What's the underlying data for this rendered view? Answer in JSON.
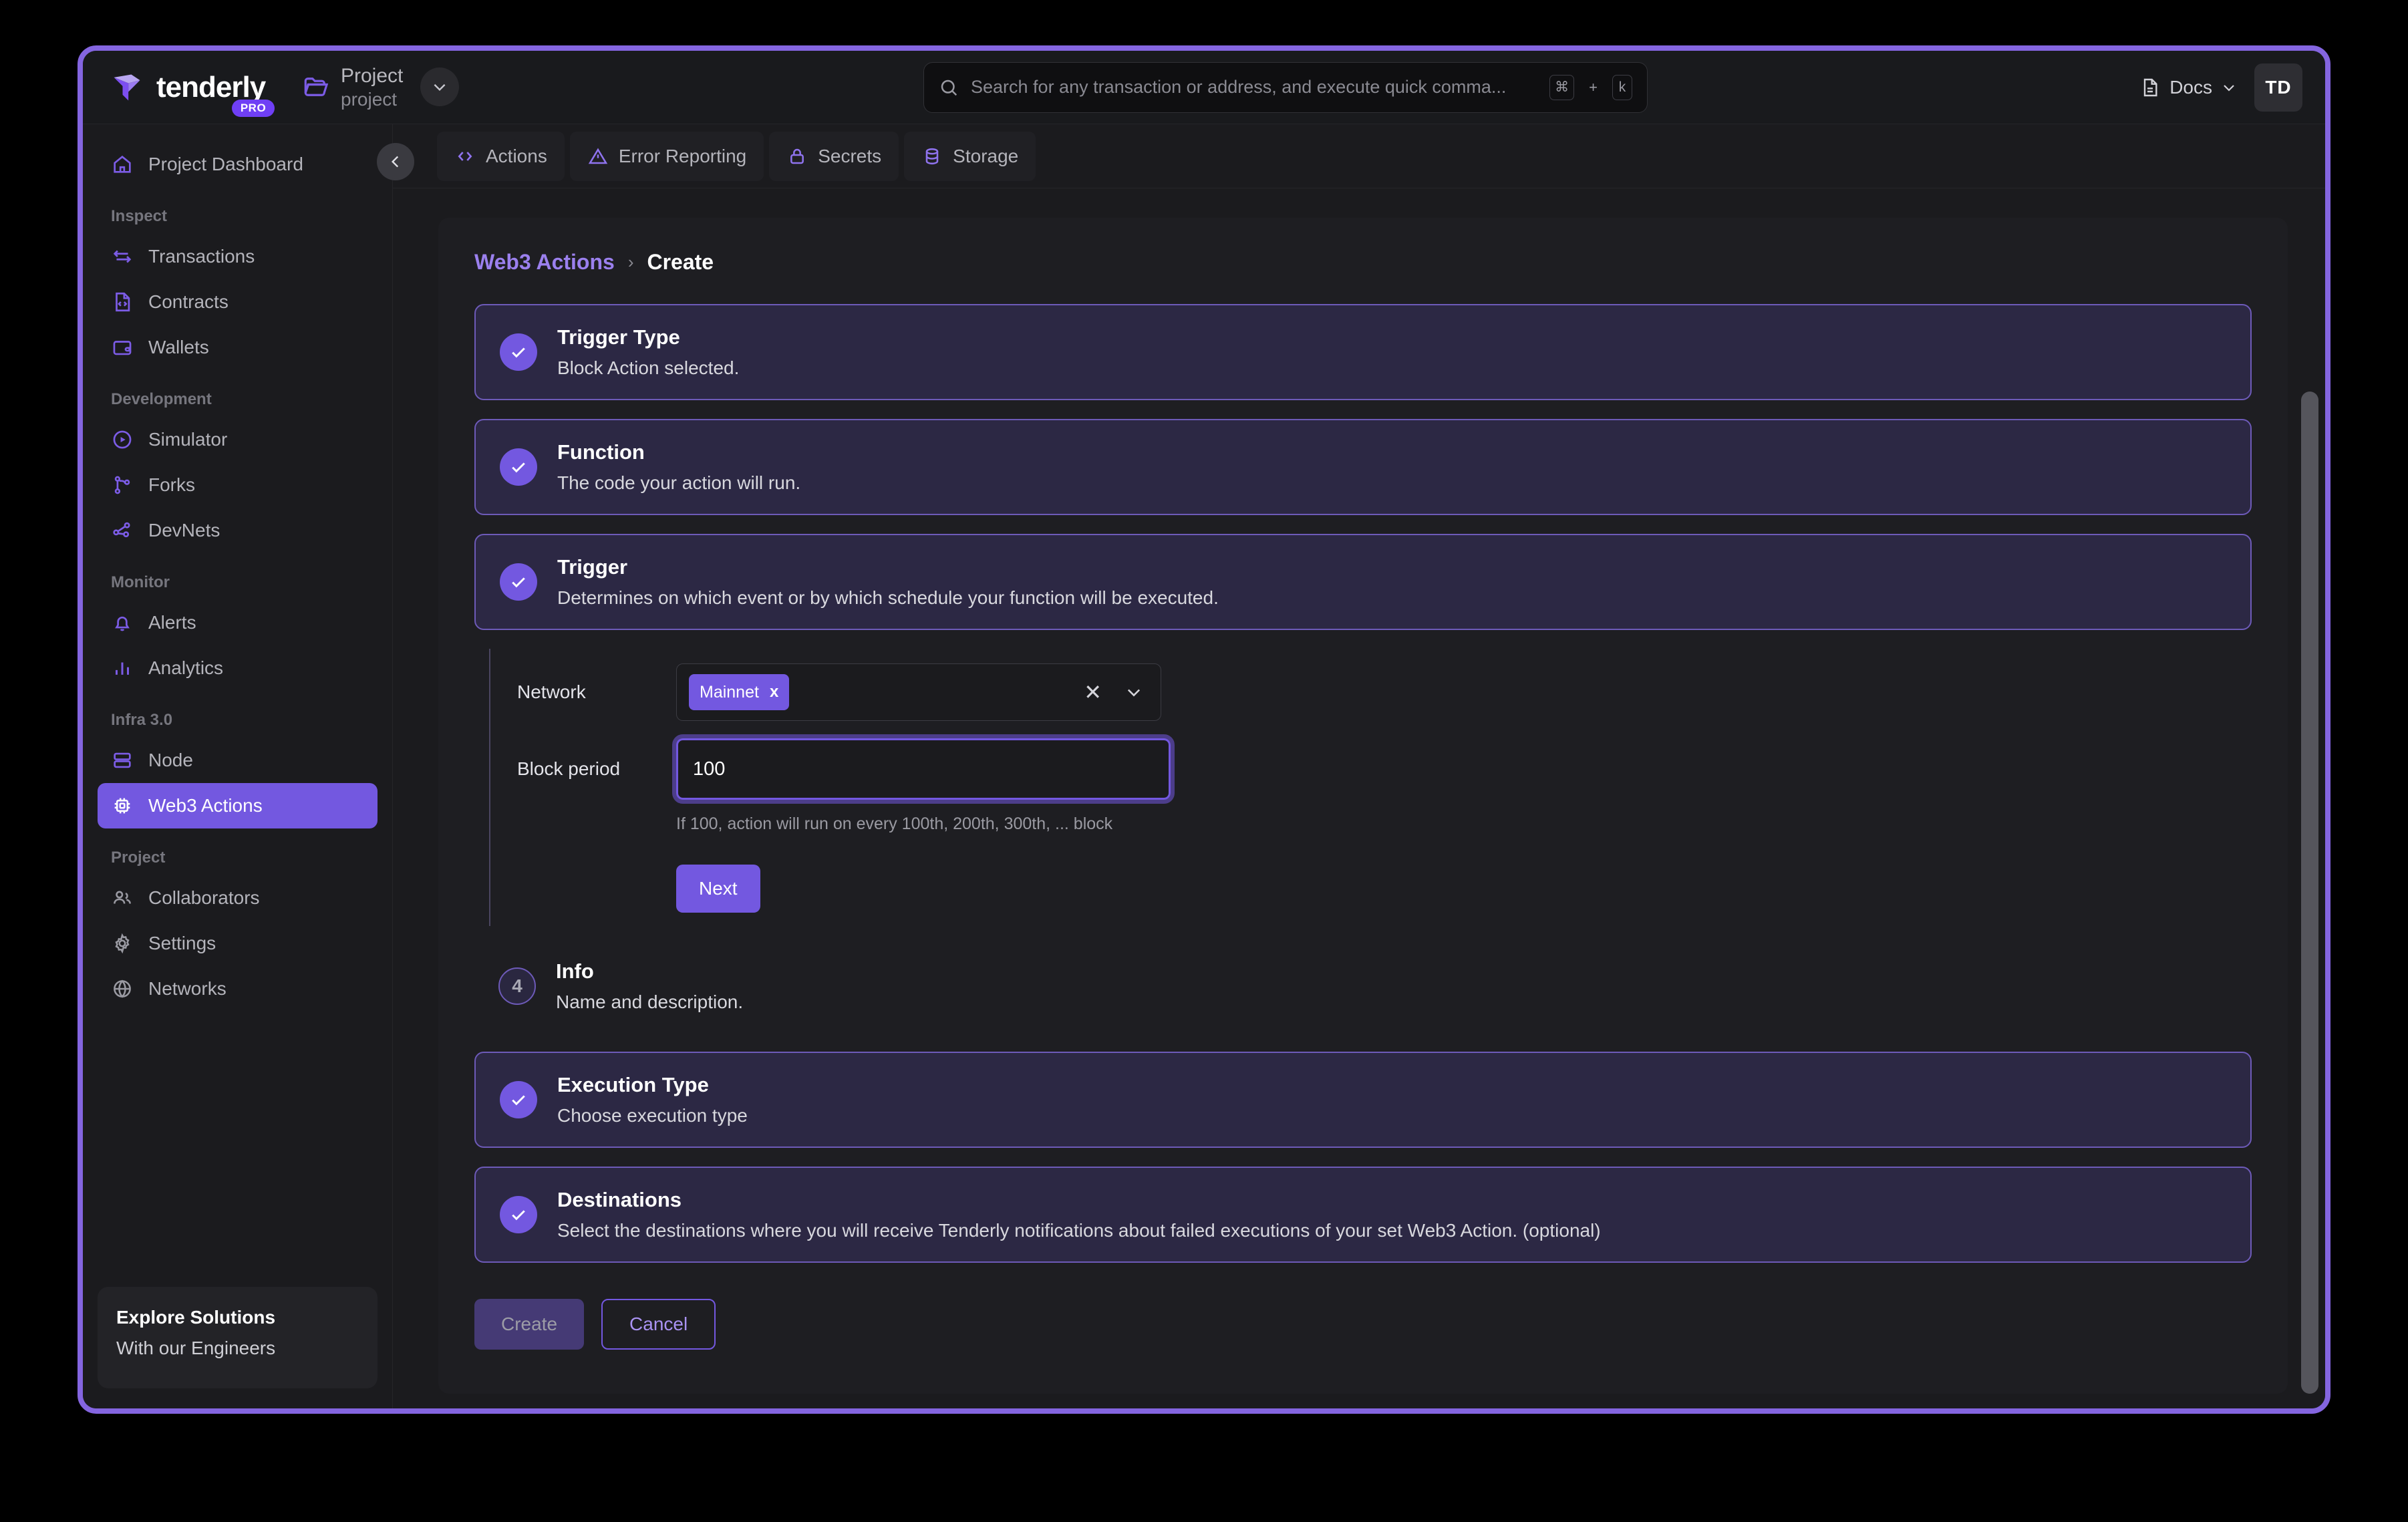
{
  "brand": {
    "name": "tenderly",
    "badge": "PRO"
  },
  "project_switcher": {
    "title": "Project",
    "subtitle": "project",
    "folder_icon": "folder-icon",
    "caret_icon": "chevron-down-icon"
  },
  "search": {
    "placeholder": "Search for any transaction or address, and execute quick comma...",
    "icon": "search-icon",
    "shortcut_key1": "⌘",
    "shortcut_plus": "+",
    "shortcut_key2": "k"
  },
  "topbar_right": {
    "docs_label": "Docs",
    "docs_icon": "document-icon",
    "docs_caret": "chevron-down-icon",
    "avatar_initials": "TD"
  },
  "sidebar": {
    "dashboard": {
      "label": "Project Dashboard",
      "icon": "home-icon"
    },
    "groups": [
      {
        "title": "Inspect",
        "items": [
          {
            "label": "Transactions",
            "icon": "transactions-icon"
          },
          {
            "label": "Contracts",
            "icon": "contract-file-icon"
          },
          {
            "label": "Wallets",
            "icon": "wallet-icon"
          }
        ]
      },
      {
        "title": "Development",
        "items": [
          {
            "label": "Simulator",
            "icon": "play-circle-icon"
          },
          {
            "label": "Forks",
            "icon": "fork-icon"
          },
          {
            "label": "DevNets",
            "icon": "devnets-icon"
          }
        ]
      },
      {
        "title": "Monitor",
        "items": [
          {
            "label": "Alerts",
            "icon": "bell-icon"
          },
          {
            "label": "Analytics",
            "icon": "bar-chart-icon"
          }
        ]
      },
      {
        "title": "Infra 3.0",
        "items": [
          {
            "label": "Node",
            "icon": "server-icon"
          },
          {
            "label": "Web3 Actions",
            "icon": "chip-icon",
            "active": true
          }
        ]
      },
      {
        "title": "Project",
        "items": [
          {
            "label": "Collaborators",
            "icon": "users-icon",
            "muted": true
          },
          {
            "label": "Settings",
            "icon": "gear-icon",
            "muted": true
          },
          {
            "label": "Networks",
            "icon": "globe-icon",
            "muted": true
          }
        ]
      }
    ],
    "footer": {
      "title": "Explore Solutions",
      "subtitle": "With our Engineers"
    }
  },
  "tabs": [
    {
      "label": "Actions",
      "icon": "code-brackets-icon"
    },
    {
      "label": "Error Reporting",
      "icon": "warning-triangle-icon"
    },
    {
      "label": "Secrets",
      "icon": "lock-icon"
    },
    {
      "label": "Storage",
      "icon": "database-icon"
    }
  ],
  "collapse_icon": "chevron-left-icon",
  "breadcrumb": {
    "parent": "Web3 Actions",
    "separator": "›",
    "current": "Create"
  },
  "steps": [
    {
      "title": "Trigger Type",
      "desc": "Block Action selected.",
      "state": "done"
    },
    {
      "title": "Function",
      "desc": "The code your action will run.",
      "state": "done"
    },
    {
      "title": "Trigger",
      "desc": "Determines on which event or by which schedule your function will be executed.",
      "state": "done"
    },
    {
      "title": "Info",
      "desc": "Name and description.",
      "state": "pending",
      "number": "4"
    },
    {
      "title": "Execution Type",
      "desc": "Choose execution type",
      "state": "done"
    },
    {
      "title": "Destinations",
      "desc": "Select the destinations where you will receive Tenderly notifications about failed executions of your set Web3 Action. (optional)",
      "state": "done"
    }
  ],
  "trigger_form": {
    "network_label": "Network",
    "network_chip": "Mainnet",
    "chip_remove": "x",
    "clear_icon": "close-icon",
    "dropdown_icon": "chevron-down-icon",
    "block_period_label": "Block period",
    "block_period_value": "100",
    "block_period_help": "If 100, action will run on every 100th, 200th, 300th, ... block",
    "next_label": "Next"
  },
  "footer_actions": {
    "create_label": "Create",
    "cancel_label": "Cancel"
  },
  "colors": {
    "accent": "#7358e0",
    "accent_light": "#9b80ee",
    "card_bg": "#2c2844",
    "window_border": "#8465e0"
  }
}
